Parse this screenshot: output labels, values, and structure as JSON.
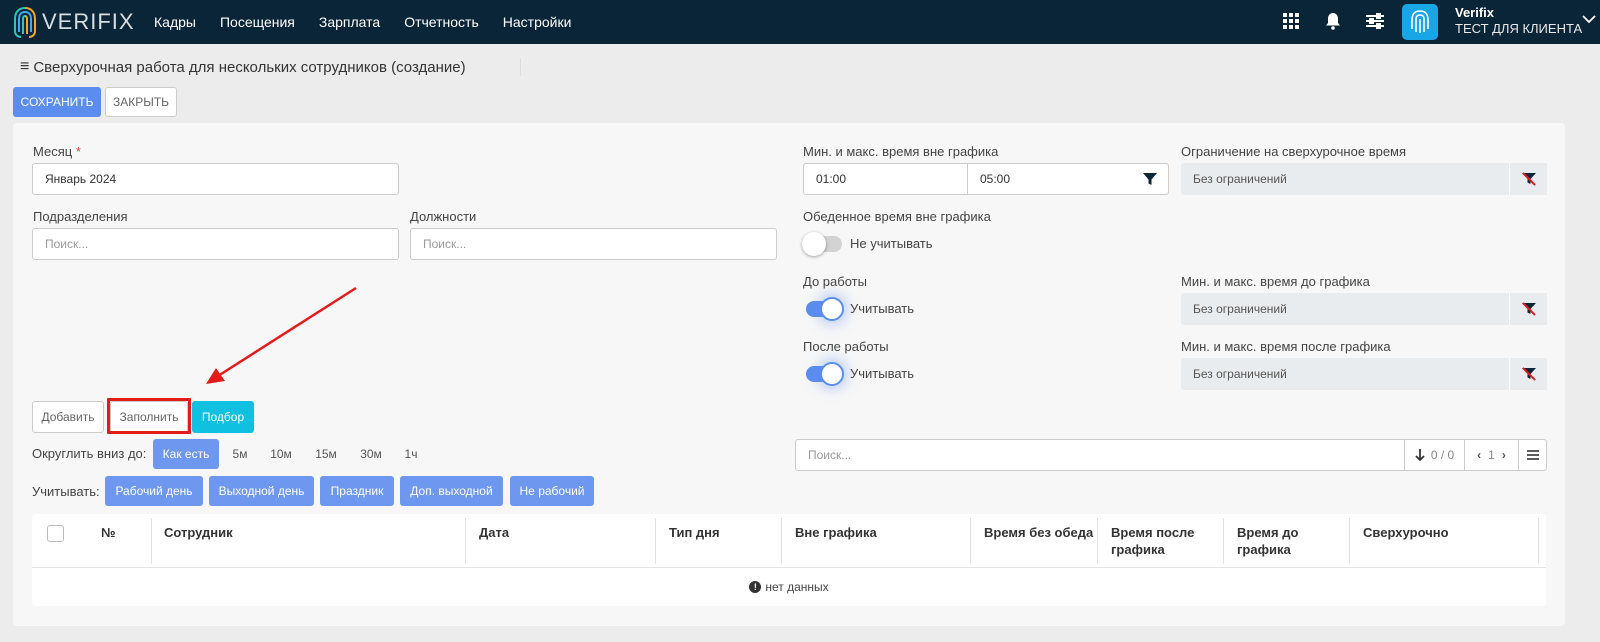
{
  "topbar": {
    "logo_text": "VERIFIX",
    "nav": [
      "Кадры",
      "Посещения",
      "Зарплата",
      "Отчетность",
      "Настройки"
    ],
    "user_name": "Verifix",
    "user_company": "ТЕСТ ДЛЯ КЛИЕНТА"
  },
  "page": {
    "title": "Сверхурочная работа для нескольких сотрудников (создание)",
    "save_label": "СОХРАНИТЬ",
    "close_label": "ЗАКРЫТЬ"
  },
  "form": {
    "month_label": "Месяц",
    "month_required": "*",
    "month_value": "Январь 2024",
    "divisions_label": "Подразделения",
    "divisions_placeholder": "Поиск...",
    "positions_label": "Должности",
    "positions_placeholder": "Поиск...",
    "offschedule_label": "Мин. и макс. время вне графика",
    "offschedule_min": "01:00",
    "offschedule_max": "05:00",
    "limit_label": "Ограничение на сверхурочное время",
    "limit_value": "Без ограничений",
    "lunch_label": "Обеденное время вне графика",
    "lunch_toggle_text": "Не учитывать",
    "lunch_toggle_on": false,
    "before_label": "До работы",
    "before_toggle_text": "Учитывать",
    "before_toggle_on": true,
    "before_range_label": "Мин. и макс. время до графика",
    "before_range_value": "Без ограничений",
    "after_label": "После работы",
    "after_toggle_text": "Учитывать",
    "after_toggle_on": true,
    "after_range_label": "Мин. и макс. время после графика",
    "after_range_value": "Без ограничений"
  },
  "actions": {
    "add": "Добавить",
    "fill": "Заполнить",
    "select": "Подбор"
  },
  "rounding": {
    "label": "Округлить вниз до:",
    "options": [
      "Как есть",
      "5м",
      "10м",
      "15м",
      "30м",
      "1ч"
    ],
    "selected": "Как есть"
  },
  "consider": {
    "label": "Учитывать:",
    "options": [
      "Рабочий день",
      "Выходной день",
      "Праздник",
      "Доп. выходной",
      "Не рабочий"
    ]
  },
  "table_search": {
    "placeholder": "Поиск...",
    "counter": "0 / 0",
    "page": "1"
  },
  "table": {
    "columns": [
      "№",
      "Сотрудник",
      "Дата",
      "Тип дня",
      "Вне графика",
      "Время без обеда",
      "Время после графика",
      "Время до графика",
      "Сверхурочно"
    ],
    "empty_text": "нет данных"
  },
  "colors": {
    "topbar": "#0b2538",
    "primary": "#5b8def",
    "cyan": "#0fc0e0",
    "annotation": "#e31b1b"
  }
}
